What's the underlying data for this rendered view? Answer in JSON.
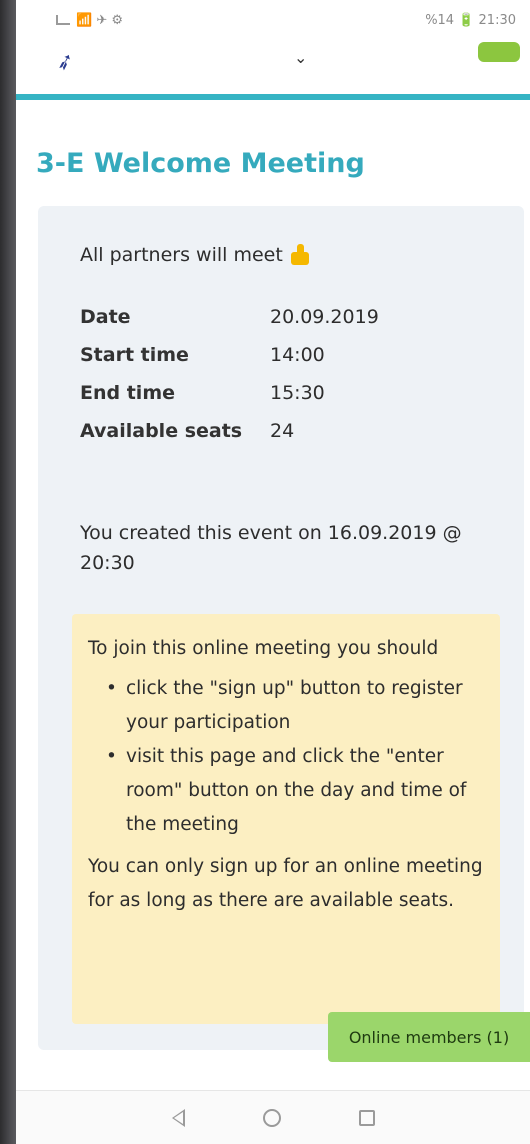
{
  "status_bar": {
    "left_icons": "📶 ✈ ⚙",
    "right": "%14 🔋 21:30"
  },
  "header": {
    "logo_icon": "bird-logo"
  },
  "page": {
    "title": "3-E Welcome Meeting"
  },
  "event": {
    "intro": "All partners will meet",
    "details": [
      {
        "label": "Date",
        "value": "20.09.2019"
      },
      {
        "label": "Start time",
        "value": "14:00"
      },
      {
        "label": "End time",
        "value": "15:30"
      },
      {
        "label": "Available seats",
        "value": "24"
      }
    ],
    "created": "You created this event on 16.09.2019 @ 20:30"
  },
  "note": {
    "lead": "To join this online meeting you should",
    "bullets": [
      "click the \"sign up\" button to register your participation",
      "visit this page and click the \"enter room\" button on the day and time of the meeting"
    ],
    "footer": "You can only sign up for an online meeting for as long as there are available seats."
  },
  "online_members": {
    "label": "Online members (1)"
  },
  "colors": {
    "accent": "#35b4c4",
    "title": "#35aabd",
    "card_bg": "#eef2f6",
    "note_bg": "#fcefc2",
    "online_bg": "#9bd66b"
  }
}
